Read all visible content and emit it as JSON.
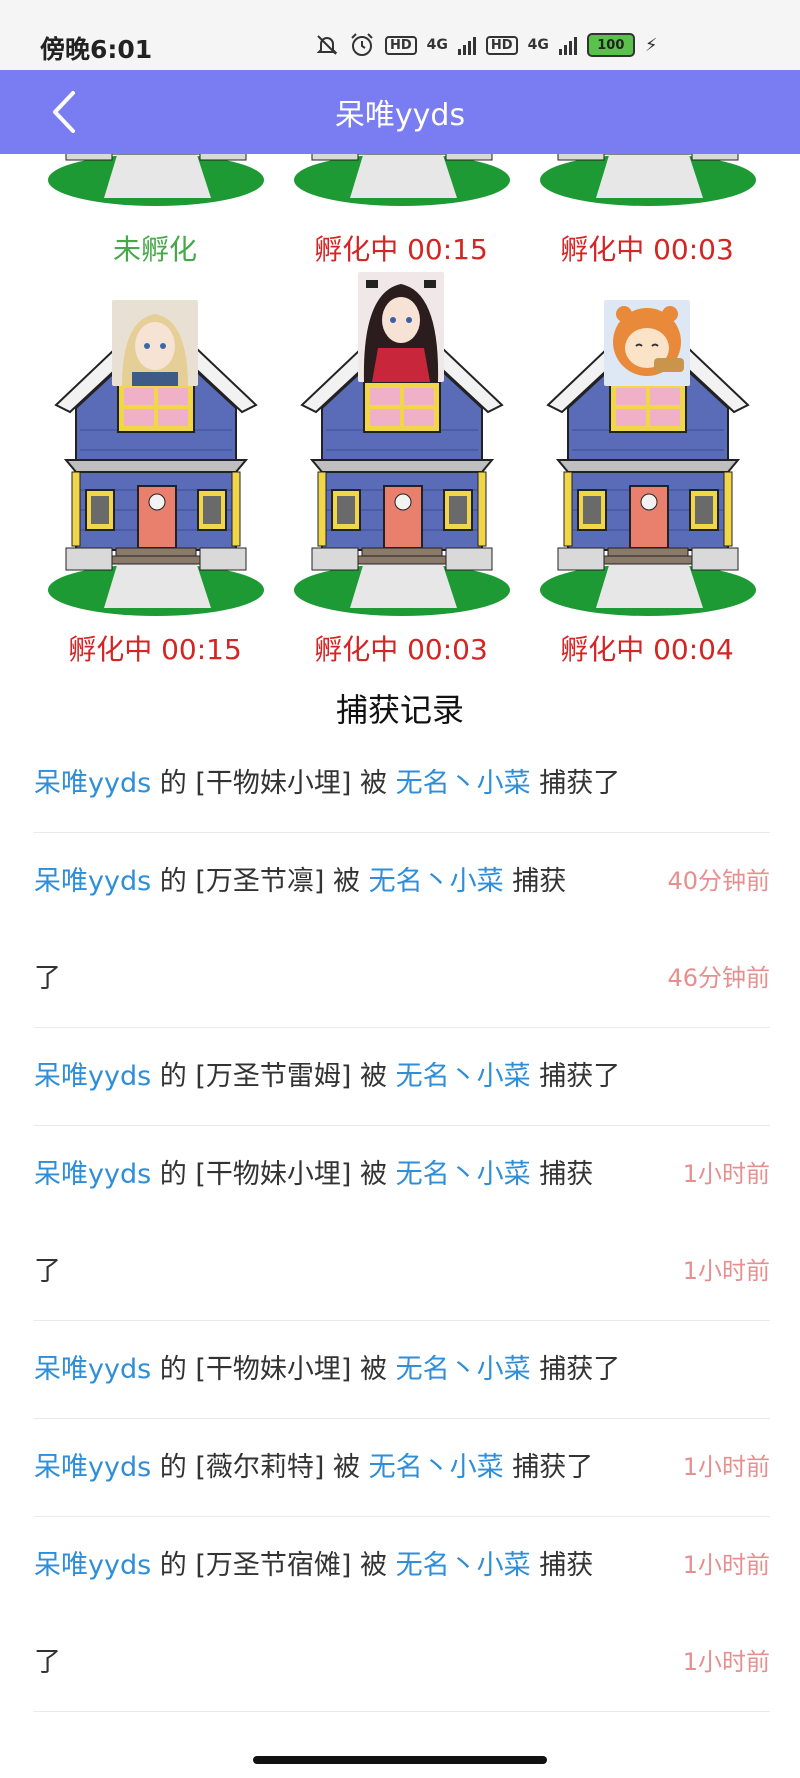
{
  "status_bar": {
    "time": "傍晚6:01",
    "hd1": "HD",
    "net1": "4G",
    "hd2": "HD",
    "net2": "4G",
    "battery": "100"
  },
  "header": {
    "title": "呆唯yyds"
  },
  "houses": {
    "row1": [
      {
        "status": "未孵化",
        "color": "green"
      },
      {
        "status": "孵化中 00:15",
        "color": "red"
      },
      {
        "status": "孵化中 00:03",
        "color": "red"
      }
    ],
    "row2": [
      {
        "status": "孵化中 00:15",
        "color": "red"
      },
      {
        "status": "孵化中 00:03",
        "color": "red"
      },
      {
        "status": "孵化中 00:04",
        "color": "red"
      }
    ]
  },
  "records_section": {
    "title": "捕获记录"
  },
  "records": [
    {
      "user": "呆唯yyds",
      "of": "的",
      "item": "[干物妹小埋]",
      "by": "被",
      "catcher": "无名丶小菜",
      "action": "捕获了",
      "time": ""
    },
    {
      "user": "呆唯yyds",
      "of": "的",
      "item": "[万圣节凛]",
      "by": "被",
      "catcher": "无名丶小菜",
      "action": "捕获",
      "action_cont": "了",
      "time": "40分钟前",
      "time2": "46分钟前"
    },
    {
      "user": "呆唯yyds",
      "of": "的",
      "item": "[万圣节雷姆]",
      "by": "被",
      "catcher": "无名丶小菜",
      "action": "捕获了",
      "time": ""
    },
    {
      "user": "呆唯yyds",
      "of": "的",
      "item": "[干物妹小埋]",
      "by": "被",
      "catcher": "无名丶小菜",
      "action": "捕获",
      "action_cont": "了",
      "time": "1小时前",
      "time2": "1小时前"
    },
    {
      "user": "呆唯yyds",
      "of": "的",
      "item": "[干物妹小埋]",
      "by": "被",
      "catcher": "无名丶小菜",
      "action": "捕获了",
      "time": ""
    },
    {
      "user": "呆唯yyds",
      "of": "的",
      "item": "[薇尔莉特]",
      "by": "被",
      "catcher": "无名丶小菜",
      "action": "捕获了",
      "time": "1小时前"
    },
    {
      "user": "呆唯yyds",
      "of": "的",
      "item": "[万圣节宿傩]",
      "by": "被",
      "catcher": "无名丶小菜",
      "action": "捕获",
      "action_cont": "了",
      "time": "1小时前",
      "time2": "1小时前"
    }
  ],
  "colors": {
    "header_bg": "#7a7cf2",
    "link_blue": "#2f8ed8",
    "status_red": "#d42525",
    "status_green": "#47a84a",
    "time_pink": "#e78f8f"
  }
}
